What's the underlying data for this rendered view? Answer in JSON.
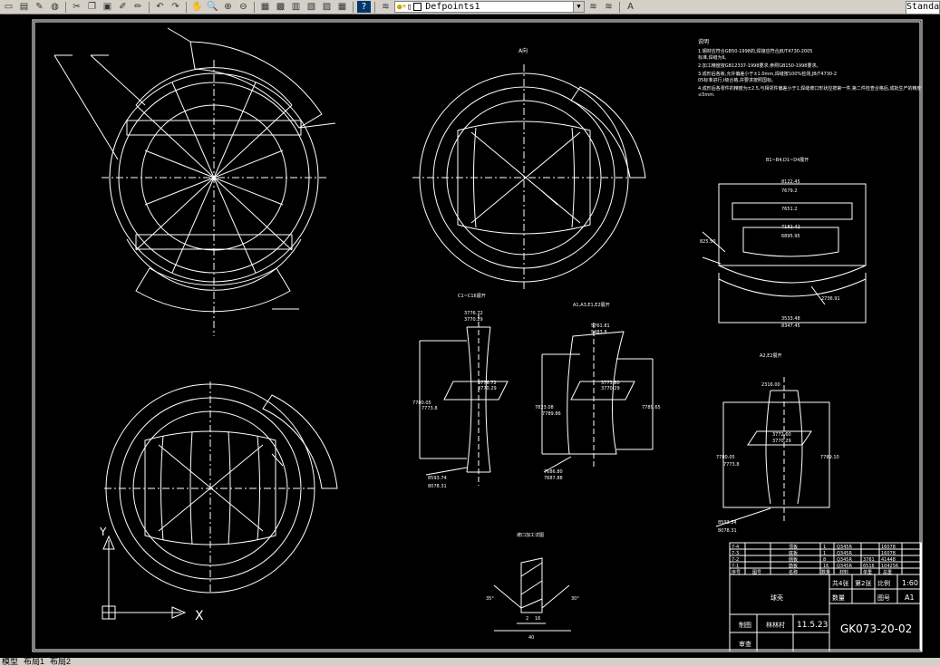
{
  "toolbar": {
    "layer_name": "Defpoints1",
    "text_style": "Standa"
  },
  "tabs": {
    "model": "模型",
    "layout1": "布局1",
    "layout2": "布局2"
  },
  "drawing": {
    "notes_title": "说明",
    "notes": [
      "1.钢材应符合GB50-1998的,焊接应符合JB/T4730-2005",
      "  标准,焊缝为Ⅱ。",
      "2.加工精度按GB12337-1998要求,参照GB150-1998要求。",
      "3.成形后各板,允许偏差小于±1.0mm,焊缝按100%检测,JB/T4730-2",
      "  05标准进行,I级合格,并要求按照国标。",
      "4.成形后各零件的精度为±2.5,与相邻件偏差小于1,焊缝坡口形状应按第一件,第二件检查合格后,成批生产的精度",
      "  ≤5mm."
    ],
    "view_a_label": "A向",
    "sec_b_title": "B1~B4,D1~D4展开",
    "sec_c_title": "C1~C16展开",
    "sec_a_title": "A1,A3,E1,E2展开",
    "sec_a2_title": "A2,E2展开",
    "weld_title": "坡口加工详图",
    "dims": {
      "b_top1": "8122.45",
      "b_top2": "7679.2",
      "b_mid": "7651.2",
      "b_inner1": "7182.42",
      "b_inner2": "6895.95",
      "b_side": "825.50",
      "b_rside": "2736.91",
      "b_bot1": "3533.48",
      "b_bot2": "8347.45",
      "c_top1": "3776.72",
      "c_top2": "3770.29",
      "c_mid1": "3776.72",
      "c_mid2": "3770.29",
      "c_left1": "7780.05",
      "c_left2": "7773.8",
      "c_bot1": "8593.74",
      "c_bot2": "8078.31",
      "a_top1": "5761.81",
      "a_top2": "5483.8",
      "a_mid1": "3773.80",
      "a_mid2": "3770.29",
      "a_left1": "7823.08",
      "a_left2": "7789.86",
      "a_right": "7789.65",
      "a_bot1": "7686.80",
      "a_bot2": "7687.88",
      "a2_top": "2316.00",
      "a2_mid1": "3772.60",
      "a2_mid2": "3770.29",
      "a2_left1": "7780.05",
      "a2_left2": "7773.8",
      "a2_right": "7789.10",
      "a2_bot1": "8593.34",
      "a2_bot2": "8078.31",
      "weld_a": "35°",
      "weld_b": "30°",
      "weld_c": "16",
      "weld_d": "2",
      "weld_e": "40"
    },
    "title_block": {
      "rows": [
        [
          "7-4",
          "",
          "顶板",
          "1",
          "Q345R",
          "",
          "16078"
        ],
        [
          "7-3",
          "",
          "底板",
          "1",
          "Q345R",
          "",
          "16078"
        ],
        [
          "7-2",
          "",
          "侧板",
          "8",
          "Q345R",
          "3761",
          "41448"
        ],
        [
          "7-1",
          "",
          "筋板",
          "16",
          "Q345R",
          "6516",
          "104256"
        ],
        [
          "序号",
          "图号",
          "名称",
          "数量",
          "材料",
          "单重",
          "总重"
        ]
      ],
      "name": "球壳",
      "sheet_total": "共4张",
      "sheet_no": "第2张",
      "scale_label": "比例",
      "scale": "1:60",
      "qty_label": "数量",
      "drawing_no_label": "图号",
      "size": "A1",
      "drawn_label": "制图",
      "drawn_name": "林林村",
      "date": "11.5.23",
      "checked_label": "审查",
      "code": "GK073-20-02"
    },
    "ucs_y": "Y",
    "ucs_x": "X"
  }
}
